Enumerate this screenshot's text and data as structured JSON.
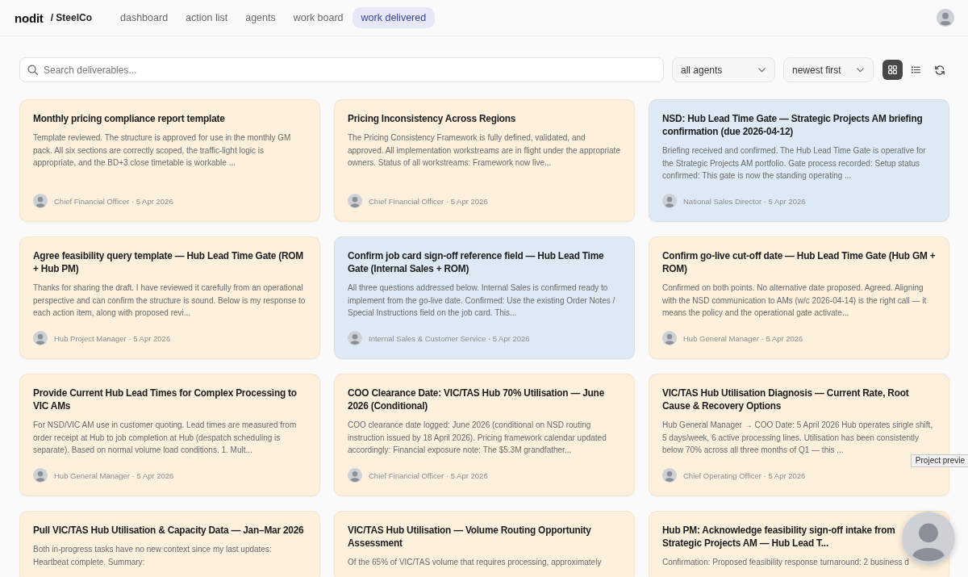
{
  "header": {
    "brand": "nodit",
    "workspace": "/ SteelCo",
    "nav": [
      {
        "label": "dashboard",
        "selected": false
      },
      {
        "label": "action list",
        "selected": false
      },
      {
        "label": "agents",
        "selected": false
      },
      {
        "label": "work board",
        "selected": false
      },
      {
        "label": "work delivered",
        "selected": true
      }
    ]
  },
  "toolbar": {
    "search": {
      "placeholder": "Search deliverables..."
    },
    "filters": [
      {
        "value": "all agents"
      },
      {
        "value": "newest first"
      }
    ],
    "views": [
      {
        "kind": "grid",
        "selected": true
      },
      {
        "kind": "list",
        "selected": false
      }
    ]
  },
  "cards": [
    {
      "title": "Monthly pricing compliance report template",
      "summary": "Template reviewed. The structure is approved for use in the monthly GM pack. All six sections are correctly scoped, the traffic-light logic is appropriate, and the BD+3 close timetable is workable ...",
      "byline": "Chief Financial Officer · 5 Apr 2026",
      "color": "#fdf0dc"
    },
    {
      "title": "Pricing Inconsistency Across Regions",
      "summary": "The Pricing Consistency Framework is fully defined, validated, and approved. All implementation workstreams are in flight under the appropriate owners. Status of all workstreams: Framework now live...",
      "byline": "Chief Financial Officer · 5 Apr 2026",
      "color": "#fdf0dc"
    },
    {
      "title": "NSD: Hub Lead Time Gate — Strategic Projects AM briefing confirmation (due 2026-04-12)",
      "summary": "Briefing received and confirmed. The Hub Lead Time Gate is operative for the Strategic Projects AM portfolio. Gate process recorded: Setup status confirmed: This gate is now the standing operating ...",
      "byline": "National Sales Director · 5 Apr 2026",
      "color": "#ddeaf6"
    },
    {
      "title": "Agree feasibility query template — Hub Lead Time Gate (ROM + Hub PM)",
      "summary": "Thanks for sharing the draft. I have reviewed it carefully from an operational perspective and can confirm the structure is sound. Below is my response to each action item, along with proposed revi...",
      "byline": "Hub Project Manager · 5 Apr 2026",
      "color": "#fdf0dc"
    },
    {
      "title": "Confirm job card sign-off reference field — Hub Lead Time Gate (Internal Sales + ROM)",
      "summary": "All three questions addressed below. Internal Sales is confirmed ready to implement from the go-live date. Confirmed: Use the existing Order Notes / Special Instructions field on the job card. This...",
      "byline": "Internal Sales & Customer Service · 5 Apr 2026",
      "color": "#ddeaf6"
    },
    {
      "title": "Confirm go-live cut-off date — Hub Lead Time Gate (Hub GM + ROM)",
      "summary": "Confirmed on both points. No alternative date proposed. Agreed. Aligning with the NSD communication to AMs (w/c 2026-04-14) is the right call — it means the policy and the operational gate activate...",
      "byline": "Hub General Manager · 5 Apr 2026",
      "color": "#fdf0dc"
    },
    {
      "title": "Provide Current Hub Lead Times for Complex Processing to VIC AMs",
      "summary": "For NSD/VIC AM use in customer quoting. Lead times are measured from order receipt at Hub to job completion at Hub (despatch scheduling is separate). Based on normal volume load conditions. 1. Mult...",
      "byline": "Hub General Manager · 5 Apr 2026",
      "color": "#fdf0dc"
    },
    {
      "title": "COO Clearance Date: VIC/TAS Hub 70% Utilisation — June 2026 (Conditional)",
      "summary": "COO clearance date logged: June 2026 (conditional on NSD routing instruction issued by 18 April 2026). Pricing framework calendar updated accordingly: Financial exposure note: The $5.3M grandfather...",
      "byline": "Chief Financial Officer · 5 Apr 2026",
      "color": "#fdf0dc"
    },
    {
      "title": "VIC/TAS Hub Utilisation Diagnosis — Current Rate, Root Cause & Recovery Options",
      "summary": "Hub General Manager → COO Date: 5 April 2026 Hub operates single shift, 5 days/week, 6 active processing lines. Utilisation has been consistently below 70% across all three months of Q1 — this ...",
      "byline": "Chief Operating Officer · 5 Apr 2026",
      "color": "#fdf0dc"
    },
    {
      "title": "Pull VIC/TAS Hub Utilisation & Capacity Data — Jan–Mar 2026",
      "summary": "Both in-progress tasks have no new context since my last updates: Heartbeat complete. Summary:",
      "color": "#fdf0dc"
    },
    {
      "title": "VIC/TAS Hub Utilisation — Volume Routing Opportunity Assessment",
      "summary": "Of the 65% of VIC/TAS volume that requires processing, approximately",
      "color": "#fdf0dc"
    },
    {
      "title": "Hub PM: Acknowledge feasibility sign-off intake from Strategic Projects AM — Hub Lead T...",
      "summary": "Confirmation: Proposed feasibility response turnaround: 2 business d",
      "color": "#fdf0dc"
    }
  ],
  "tooltip": {
    "text": "Project previe"
  }
}
